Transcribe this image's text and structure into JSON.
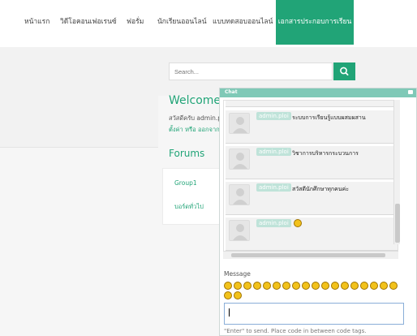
{
  "nav": {
    "items": [
      "หน้าแรก",
      "วิดีโอคอนเฟอเรนซ์",
      "ฟอรั่ม",
      "นักเรียนออนไลน์",
      "แบบทดสอบออนไลน์",
      "เอกสารประกอบการเรียน"
    ],
    "active": "เอกสารประกอบการเรียน"
  },
  "search": {
    "placeholder": "Search..."
  },
  "welcome": {
    "title": "Welcome t",
    "greeting": "สวัสดีครับ admin.p",
    "links": "ตั้งค่า หรือ ออกจาก"
  },
  "forums": {
    "title": "Forums",
    "items": [
      "Group1",
      "บอร์ดทั่วไป"
    ]
  },
  "chat": {
    "title": "Chat",
    "messages": [
      {
        "user": "admin.ploi",
        "text": "ระบบการเรียนรู้แบบผสมผสาน"
      },
      {
        "user": "admin.ploi",
        "text": "วิชาการบริหารกระบวนการ"
      },
      {
        "user": "admin.ploi",
        "text": "สวัสดีนักศึกษาทุกคนค่ะ"
      },
      {
        "user": "admin.ploi",
        "text": "",
        "icon": "smiley-icon"
      }
    ],
    "message_label": "Message",
    "hint": "\"Enter\" to send. Place code in between code tags.",
    "emoji_icons": [
      "smile",
      "grin",
      "wink",
      "blush",
      "tongue",
      "cool",
      "laugh",
      "happy",
      "surprised",
      "sad",
      "confused",
      "angry",
      "cry",
      "evil",
      "devil",
      "neutral",
      "exclaim",
      "question",
      "idea",
      "arrow"
    ]
  },
  "colors": {
    "accent": "#21a477",
    "chat_header": "#7fc9b7"
  }
}
